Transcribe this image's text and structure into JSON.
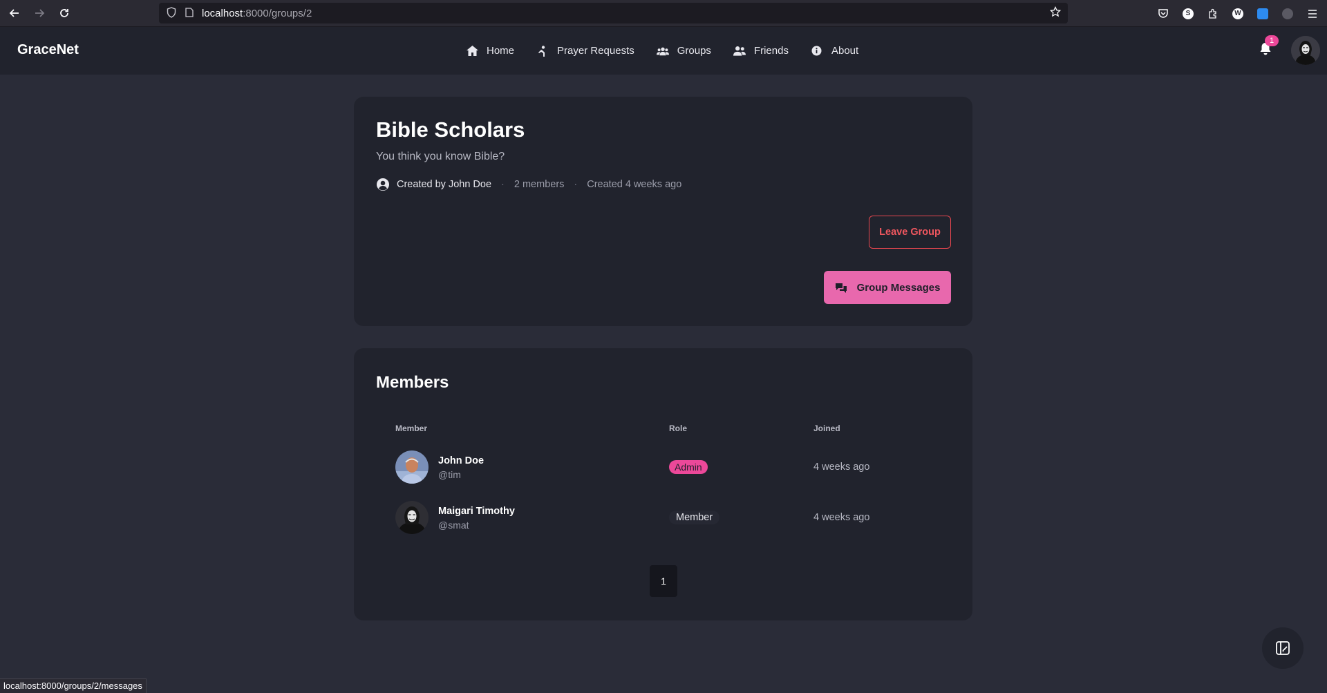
{
  "browser": {
    "url_host": "localhost",
    "url_path": ":8000/groups/2",
    "status_url": "localhost:8000/groups/2/messages"
  },
  "header": {
    "brand": "GraceNet",
    "nav": [
      {
        "label": "Home",
        "icon": "home-icon"
      },
      {
        "label": "Prayer Requests",
        "icon": "praying-icon"
      },
      {
        "label": "Groups",
        "icon": "users-icon"
      },
      {
        "label": "Friends",
        "icon": "user-friends-icon"
      },
      {
        "label": "About",
        "icon": "info-icon"
      }
    ],
    "notification_count": "1"
  },
  "group": {
    "title": "Bible Scholars",
    "description": "You think you know Bible?",
    "creator": "Created by John Doe",
    "member_count": "2 members",
    "created": "Created 4 weeks ago",
    "leave_label": "Leave Group",
    "messages_label": "Group Messages"
  },
  "members": {
    "title": "Members",
    "columns": {
      "member": "Member",
      "role": "Role",
      "joined": "Joined"
    },
    "rows": [
      {
        "name": "John Doe",
        "handle": "@tim",
        "role": "Admin",
        "joined": "4 weeks ago"
      },
      {
        "name": "Maigari Timothy",
        "handle": "@smat",
        "role": "Member",
        "joined": "4 weeks ago"
      }
    ],
    "page": "1"
  },
  "colors": {
    "accent": "#ec4899",
    "danger": "#e8474f",
    "card": "#21232d",
    "background": "#2a2c38"
  }
}
